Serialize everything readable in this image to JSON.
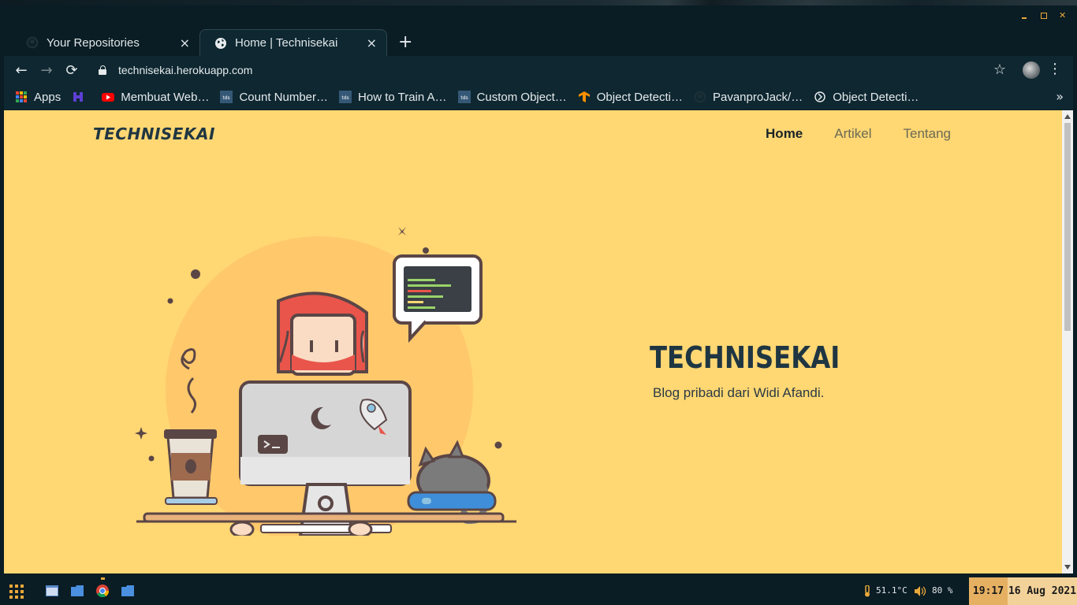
{
  "window": {
    "tabs": [
      {
        "title": "Your Repositories",
        "active": false,
        "icon": "github-icon"
      },
      {
        "title": "Home | Technisekai",
        "active": true,
        "icon": "globe-icon"
      }
    ],
    "new_tab_label": "+",
    "tab_close_label": "×"
  },
  "toolbar": {
    "url": "technisekai.herokuapp.com"
  },
  "bookmarks": [
    {
      "label": "Apps",
      "icon": "apps-grid-icon"
    },
    {
      "label": "",
      "icon": "hackerrank-icon"
    },
    {
      "label": "Membuat Web…",
      "icon": "youtube-icon"
    },
    {
      "label": "Count Number…",
      "icon": "tds-icon"
    },
    {
      "label": "How to Train A…",
      "icon": "tds-icon"
    },
    {
      "label": "Custom Object…",
      "icon": "tds-icon"
    },
    {
      "label": "Object Detecti…",
      "icon": "tensorflow-icon"
    },
    {
      "label": "PavanproJack/…",
      "icon": "github-icon"
    },
    {
      "label": "Object Detecti…",
      "icon": "site-icon"
    }
  ],
  "page": {
    "brand": "TECHNISEKAI",
    "nav": [
      {
        "label": "Home",
        "current": true
      },
      {
        "label": "Artikel",
        "current": false
      },
      {
        "label": "Tentang",
        "current": false
      }
    ],
    "hero_title": "TECHNISEKAI",
    "hero_subtitle": "Blog pribadi dari Widi Afandi.",
    "background_color": "#ffd773"
  },
  "taskbar": {
    "temperature": "51.1°C",
    "volume": "80 %",
    "time": "19:17",
    "date": "16 Aug 2021"
  }
}
